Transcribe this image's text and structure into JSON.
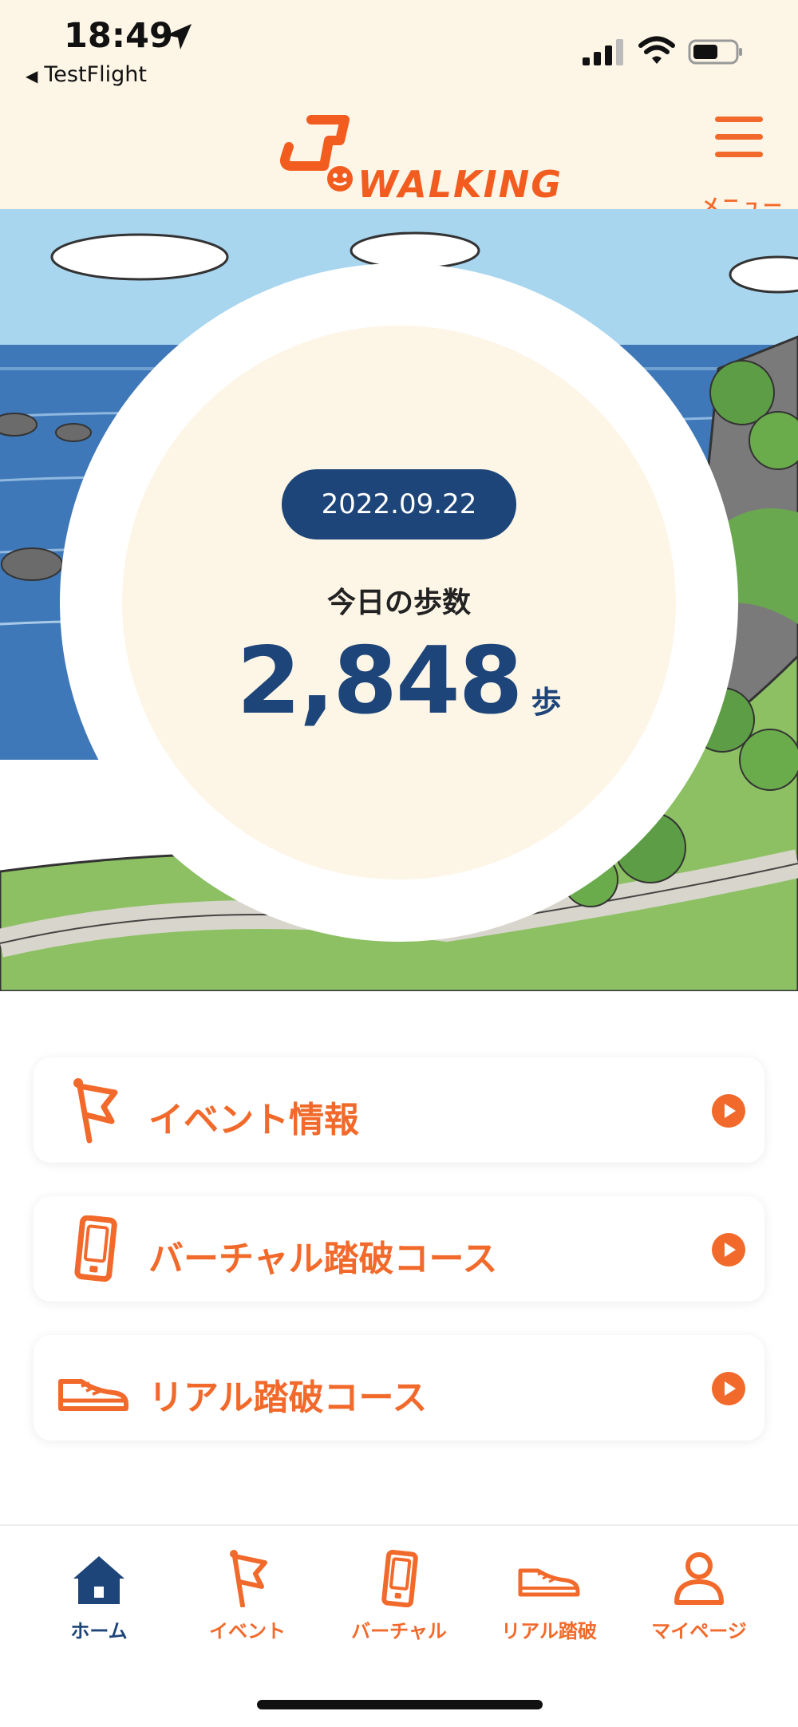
{
  "status_bar": {
    "time": "18:49",
    "back_app": "TestFlight"
  },
  "header": {
    "logo_text": "WALKING",
    "menu_label": "メニュー"
  },
  "today": {
    "date": "2022.09.22",
    "label": "今日の歩数",
    "steps": "2,848",
    "unit": "歩"
  },
  "cards": [
    {
      "label": "イベント情報",
      "icon": "flag-icon"
    },
    {
      "label": "バーチャル踏破コース",
      "icon": "phone-icon"
    },
    {
      "label": "リアル踏破コース",
      "icon": "shoe-icon"
    }
  ],
  "tabs": [
    {
      "label": "ホーム",
      "icon": "home-icon",
      "active": true
    },
    {
      "label": "イベント",
      "icon": "flag-icon"
    },
    {
      "label": "バーチャル",
      "icon": "phone-icon"
    },
    {
      "label": "リアル踏破",
      "icon": "shoe-icon"
    },
    {
      "label": "マイページ",
      "icon": "user-icon"
    }
  ],
  "colors": {
    "accent": "#f26a2b",
    "navy": "#1d4579",
    "cream": "#fdf5e6"
  }
}
